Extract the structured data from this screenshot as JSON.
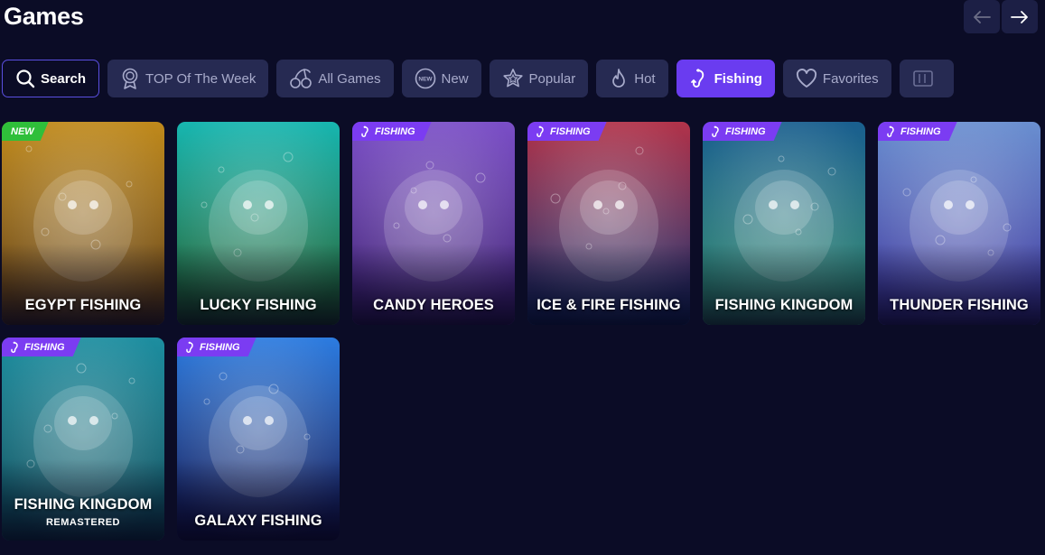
{
  "page": {
    "title": "Games"
  },
  "filters": [
    {
      "label": "Search",
      "icon": "search-icon",
      "style": "search"
    },
    {
      "label": "TOP Of The Week",
      "icon": "medal-icon",
      "style": "default"
    },
    {
      "label": "All Games",
      "icon": "cherries-icon",
      "style": "default"
    },
    {
      "label": "New",
      "icon": "new-icon",
      "style": "default"
    },
    {
      "label": "Popular",
      "icon": "star-icon",
      "style": "default"
    },
    {
      "label": "Hot",
      "icon": "flame-icon",
      "style": "default"
    },
    {
      "label": "Fishing",
      "icon": "fishing-hook-icon",
      "style": "active"
    },
    {
      "label": "Favorites",
      "icon": "heart-icon",
      "style": "default"
    },
    {
      "label": "",
      "icon": "slot-machine-icon",
      "style": "partial"
    }
  ],
  "badges": {
    "fishing": "FISHING",
    "new": "NEW"
  },
  "games": [
    {
      "title": "EGYPT FISHING",
      "subtitle": "",
      "badge": "new",
      "colors": [
        "#c08a1c",
        "#5b3a12"
      ]
    },
    {
      "title": "LUCKY FISHING",
      "subtitle": "",
      "badge": "",
      "colors": [
        "#18b6b0",
        "#1f5a25"
      ]
    },
    {
      "title": "CANDY HEROES",
      "subtitle": "",
      "badge": "fishing",
      "colors": [
        "#7b4fc7",
        "#3b1d6e"
      ]
    },
    {
      "title": "ICE & FIRE FISHING",
      "subtitle": "",
      "badge": "fishing",
      "colors": [
        "#b2334a",
        "#0f2c6b"
      ]
    },
    {
      "title": "FISHING KINGDOM",
      "subtitle": "",
      "badge": "fishing",
      "colors": [
        "#1a5f8f",
        "#2f8a6a"
      ]
    },
    {
      "title": "THUNDER FISHING",
      "subtitle": "",
      "badge": "fishing",
      "colors": [
        "#6a8fd0",
        "#3a2f9a"
      ]
    },
    {
      "title": "FISHING KINGDOM",
      "subtitle": "REMASTERED",
      "badge": "fishing",
      "colors": [
        "#1d8ea0",
        "#0d4a57"
      ]
    },
    {
      "title": "GALAXY FISHING",
      "subtitle": "",
      "badge": "fishing",
      "colors": [
        "#2d7ce0",
        "#12114a"
      ]
    }
  ]
}
